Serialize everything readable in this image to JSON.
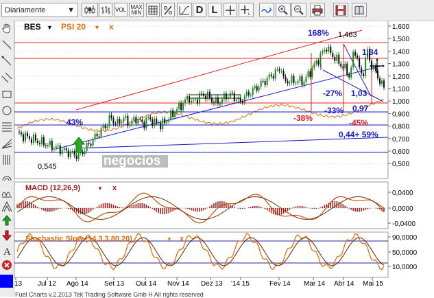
{
  "toolbar": {
    "period_label": "Diariamente",
    "vol_label": "VOL",
    "minmax_label_1": "MAX",
    "minmax_label_2": "MIN",
    "d_label": "D",
    "l_label": "L"
  },
  "legend": {
    "symbol": "BES",
    "compare": "PSI 20",
    "close": "x"
  },
  "macd": {
    "label": "MACD (12,26,9)",
    "close": "x"
  },
  "stoch": {
    "label": "Stochastic Slow (14,3,3,80,20)",
    "close": "x"
  },
  "price_axis": [
    "1,600",
    "1,500",
    "1,400",
    "1,300",
    "1,200",
    "1,100",
    "1,000",
    "0,900",
    "0,800",
    "0,700",
    "0,600",
    "0,500"
  ],
  "macd_axis": [
    "0,0400",
    "0,0000",
    "-0,0400"
  ],
  "stoch_axis": [
    "90,0000",
    "50,0000",
    "10,0000"
  ],
  "dates": [
    "13",
    "Jul 12",
    "Ago 14",
    "Set 13",
    "Out 14",
    "Nov 14",
    "Dez 13",
    "'14 15",
    "Fev 14",
    "Mar 14",
    "Abr 14",
    "Mai 15"
  ],
  "annotations": {
    "pct168": "168%",
    "high": "1,463",
    "v134": "1,34",
    "pct43": "43%",
    "pct27": "-27%",
    "v103": "1,03",
    "pct33": "-33%",
    "v097": "0,97",
    "pct38": "-38%",
    "pct45": "-45%",
    "v044": "0,44+ 59%",
    "low": "0,545"
  },
  "watermark": "negocios",
  "footer": "Fuel Charts v.2.2013 Tek Trading Software Gmb H All rights reserved",
  "colors": {
    "price_up": "#1a8a1a",
    "price_down": "#0d0d0d",
    "compare_line": "#e07010",
    "trend_red": "#e02020",
    "trend_blue": "#1a1ac8",
    "macd_hist": "#a01818"
  }
}
